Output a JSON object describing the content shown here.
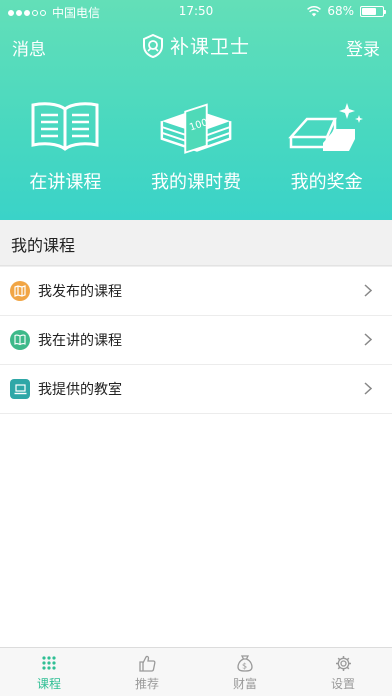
{
  "status_bar": {
    "carrier": "中国电信",
    "time": "17:50",
    "battery": "68%",
    "battery_level": 0.68
  },
  "nav": {
    "left": "消息",
    "title": "补课卫士",
    "right": "登录"
  },
  "hero_items": [
    {
      "label": "在讲课程",
      "icon": "open-book-icon"
    },
    {
      "label": "我的课时费",
      "icon": "cash-stack-icon"
    },
    {
      "label": "我的奖金",
      "icon": "gold-bars-icon"
    }
  ],
  "section_title": "我的课程",
  "list_items": [
    {
      "label": "我发布的课程",
      "icon": "map-icon",
      "color": "#f1a545"
    },
    {
      "label": "我在讲的课程",
      "icon": "book-icon",
      "color": "#3db989"
    },
    {
      "label": "我提供的教室",
      "icon": "laptop-icon",
      "color": "#2fa7a7"
    }
  ],
  "tabs": [
    {
      "label": "课程",
      "icon": "grid-icon",
      "active": true
    },
    {
      "label": "推荐",
      "icon": "thumbs-up-icon",
      "active": false
    },
    {
      "label": "财富",
      "icon": "money-bag-icon",
      "active": false
    },
    {
      "label": "设置",
      "icon": "gear-icon",
      "active": false
    }
  ],
  "colors": {
    "accent": "#2fbf94",
    "hero_top": "#63dfb8",
    "hero_bottom": "#3ad3c8"
  }
}
